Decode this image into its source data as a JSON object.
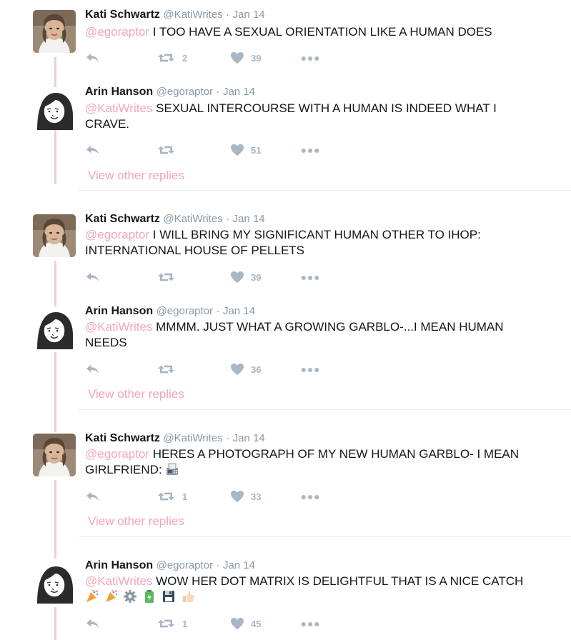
{
  "tweets": [
    {
      "name": "Kati Schwartz",
      "handle": "@KatiWrites",
      "sep": "·",
      "date": "Jan 14",
      "mention": "@egoraptor",
      "text": "I TOO HAVE A SEXUAL ORIENTATION LIKE A HUMAN DOES",
      "retweets": "2",
      "likes": "39",
      "avatar": "kati-avatar"
    },
    {
      "name": "Arin Hanson",
      "handle": "@egoraptor",
      "sep": "·",
      "date": "Jan 14",
      "mention": "@KatiWrites",
      "text": "SEXUAL INTERCOURSE WITH A HUMAN IS INDEED WHAT I CRAVE.",
      "retweets": "",
      "likes": "51",
      "avatar": "arin-avatar"
    },
    {
      "name": "Kati Schwartz",
      "handle": "@KatiWrites",
      "sep": "·",
      "date": "Jan 14",
      "mention": "@egoraptor",
      "text": "I WILL BRING MY SIGNIFICANT HUMAN OTHER TO IHOP: INTERNATIONAL HOUSE OF PELLETS",
      "retweets": "",
      "likes": "39",
      "avatar": "kati-avatar"
    },
    {
      "name": "Arin Hanson",
      "handle": "@egoraptor",
      "sep": "·",
      "date": "Jan 14",
      "mention": "@KatiWrites",
      "text": "MMMM. JUST WHAT A GROWING GARBLO-...I MEAN HUMAN NEEDS",
      "retweets": "",
      "likes": "36",
      "avatar": "arin-avatar"
    },
    {
      "name": "Kati Schwartz",
      "handle": "@KatiWrites",
      "sep": "·",
      "date": "Jan 14",
      "mention": "@egoraptor",
      "text": "HERES A PHOTOGRAPH OF MY NEW HUMAN GARBLO- I MEAN GIRLFRIEND:",
      "emojis": [
        "fax-machine-emoji"
      ],
      "retweets": "1",
      "likes": "33",
      "avatar": "kati-avatar"
    },
    {
      "name": "Arin Hanson",
      "handle": "@egoraptor",
      "sep": "·",
      "date": "Jan 14",
      "mention": "@KatiWrites",
      "text": "WOW HER DOT MATRIX IS DELIGHTFUL THAT IS A NICE CATCH",
      "emojis": [
        "party-popper-emoji",
        "party-popper-emoji",
        "gear-emoji",
        "battery-emoji",
        "floppy-disk-emoji",
        "thumbs-up-emoji"
      ],
      "retweets": "1",
      "likes": "45",
      "avatar": "arin-avatar"
    }
  ],
  "view_other_replies": "View other replies",
  "colors": {
    "mention": "#f3a6b6",
    "thread_line": "#f5ccd4",
    "meta": "#8899a6",
    "action": "#a9b6c3"
  }
}
